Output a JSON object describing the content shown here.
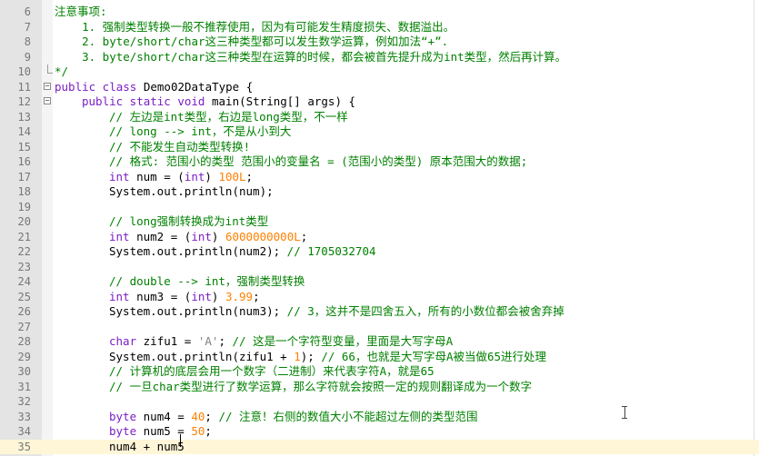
{
  "editor": {
    "lines": [
      {
        "n": "6",
        "fold": "",
        "indent": 0,
        "t": [
          {
            "c": "cm",
            "s": "注意事项:"
          }
        ]
      },
      {
        "n": "7",
        "fold": "",
        "indent": 0,
        "t": [
          {
            "c": "cm",
            "s": "    1. 强制类型转换一般不推荐使用，因为有可能发生精度损失、数据溢出。"
          }
        ]
      },
      {
        "n": "8",
        "fold": "",
        "indent": 0,
        "t": [
          {
            "c": "cm",
            "s": "    2. byte/short/char这三种类型都可以发生数学运算，例如加法“+”."
          }
        ]
      },
      {
        "n": "9",
        "fold": "",
        "indent": 0,
        "t": [
          {
            "c": "cm",
            "s": "    3. byte/short/char这三种类型在运算的时候，都会被首先提升成为int类型，然后再计算。"
          }
        ]
      },
      {
        "n": "10",
        "fold": "end",
        "indent": 0,
        "t": [
          {
            "c": "cm",
            "s": "*/"
          }
        ]
      },
      {
        "n": "11",
        "fold": "open",
        "indent": 0,
        "t": [
          {
            "c": "kw",
            "s": "public class "
          },
          {
            "c": "plain",
            "s": "Demo02DataType {"
          }
        ]
      },
      {
        "n": "12",
        "fold": "open",
        "indent": 4,
        "t": [
          {
            "c": "kw",
            "s": "public static void "
          },
          {
            "c": "plain",
            "s": "main(String[] args) {"
          }
        ]
      },
      {
        "n": "13",
        "fold": "",
        "indent": 8,
        "t": [
          {
            "c": "cm",
            "s": "// 左边是int类型，右边是long类型，不一样"
          }
        ]
      },
      {
        "n": "14",
        "fold": "",
        "indent": 8,
        "t": [
          {
            "c": "cm",
            "s": "// long --> int，不是从小到大"
          }
        ]
      },
      {
        "n": "15",
        "fold": "",
        "indent": 8,
        "t": [
          {
            "c": "cm",
            "s": "// 不能发生自动类型转换!"
          }
        ]
      },
      {
        "n": "16",
        "fold": "",
        "indent": 8,
        "t": [
          {
            "c": "cm",
            "s": "// 格式: 范围小的类型 范围小的变量名 = (范围小的类型) 原本范围大的数据;"
          }
        ]
      },
      {
        "n": "17",
        "fold": "",
        "indent": 8,
        "t": [
          {
            "c": "kw",
            "s": "int "
          },
          {
            "c": "plain",
            "s": "num = ("
          },
          {
            "c": "kw",
            "s": "int"
          },
          {
            "c": "plain",
            "s": ") "
          },
          {
            "c": "num",
            "s": "100L"
          },
          {
            "c": "plain",
            "s": ";"
          }
        ]
      },
      {
        "n": "18",
        "fold": "",
        "indent": 8,
        "t": [
          {
            "c": "plain",
            "s": "System.out.println(num);"
          }
        ]
      },
      {
        "n": "19",
        "fold": "",
        "indent": 0,
        "t": []
      },
      {
        "n": "20",
        "fold": "",
        "indent": 8,
        "t": [
          {
            "c": "cm",
            "s": "// long强制转换成为int类型"
          }
        ]
      },
      {
        "n": "21",
        "fold": "",
        "indent": 8,
        "t": [
          {
            "c": "kw",
            "s": "int "
          },
          {
            "c": "plain",
            "s": "num2 = ("
          },
          {
            "c": "kw",
            "s": "int"
          },
          {
            "c": "plain",
            "s": ") "
          },
          {
            "c": "num",
            "s": "6000000000L"
          },
          {
            "c": "plain",
            "s": ";"
          }
        ]
      },
      {
        "n": "22",
        "fold": "",
        "indent": 8,
        "t": [
          {
            "c": "plain",
            "s": "System.out.println(num2); "
          },
          {
            "c": "cm",
            "s": "// 1705032704"
          }
        ]
      },
      {
        "n": "23",
        "fold": "",
        "indent": 0,
        "t": []
      },
      {
        "n": "24",
        "fold": "",
        "indent": 8,
        "t": [
          {
            "c": "cm",
            "s": "// double --> int，强制类型转换"
          }
        ]
      },
      {
        "n": "25",
        "fold": "",
        "indent": 8,
        "t": [
          {
            "c": "kw",
            "s": "int "
          },
          {
            "c": "plain",
            "s": "num3 = ("
          },
          {
            "c": "kw",
            "s": "int"
          },
          {
            "c": "plain",
            "s": ") "
          },
          {
            "c": "num",
            "s": "3.99"
          },
          {
            "c": "plain",
            "s": ";"
          }
        ]
      },
      {
        "n": "26",
        "fold": "",
        "indent": 8,
        "t": [
          {
            "c": "plain",
            "s": "System.out.println(num3); "
          },
          {
            "c": "cm",
            "s": "// 3，这并不是四舍五入，所有的小数位都会被舍弃掉"
          }
        ]
      },
      {
        "n": "27",
        "fold": "",
        "indent": 0,
        "t": []
      },
      {
        "n": "28",
        "fold": "",
        "indent": 8,
        "t": [
          {
            "c": "kw",
            "s": "char "
          },
          {
            "c": "plain",
            "s": "zifu1 = "
          },
          {
            "c": "str",
            "s": "'A'"
          },
          {
            "c": "plain",
            "s": "; "
          },
          {
            "c": "cm",
            "s": "// 这是一个字符型变量，里面是大写字母A"
          }
        ]
      },
      {
        "n": "29",
        "fold": "",
        "indent": 8,
        "t": [
          {
            "c": "plain",
            "s": "System.out.println(zifu1 + "
          },
          {
            "c": "num",
            "s": "1"
          },
          {
            "c": "plain",
            "s": "); "
          },
          {
            "c": "cm",
            "s": "// 66，也就是大写字母A被当做65进行处理"
          }
        ]
      },
      {
        "n": "30",
        "fold": "",
        "indent": 8,
        "t": [
          {
            "c": "cm",
            "s": "// 计算机的底层会用一个数字（二进制）来代表字符A，就是65"
          }
        ]
      },
      {
        "n": "31",
        "fold": "",
        "indent": 8,
        "t": [
          {
            "c": "cm",
            "s": "// 一旦char类型进行了数学运算，那么字符就会按照一定的规则翻译成为一个数字"
          }
        ]
      },
      {
        "n": "32",
        "fold": "",
        "indent": 0,
        "t": []
      },
      {
        "n": "33",
        "fold": "",
        "indent": 8,
        "t": [
          {
            "c": "kw",
            "s": "byte "
          },
          {
            "c": "plain",
            "s": "num4 = "
          },
          {
            "c": "num",
            "s": "40"
          },
          {
            "c": "plain",
            "s": "; "
          },
          {
            "c": "cm",
            "s": "// 注意！右侧的数值大小不能超过左侧的类型范围"
          }
        ]
      },
      {
        "n": "34",
        "fold": "",
        "indent": 8,
        "t": [
          {
            "c": "kw",
            "s": "byte "
          },
          {
            "c": "plain",
            "s": "num5 = "
          },
          {
            "c": "num",
            "s": "50"
          },
          {
            "c": "plain",
            "s": ";"
          }
        ]
      },
      {
        "n": "35",
        "fold": "",
        "indent": 8,
        "current": true,
        "t": [
          {
            "c": "plain",
            "s": "num4 + num5"
          }
        ]
      }
    ]
  }
}
